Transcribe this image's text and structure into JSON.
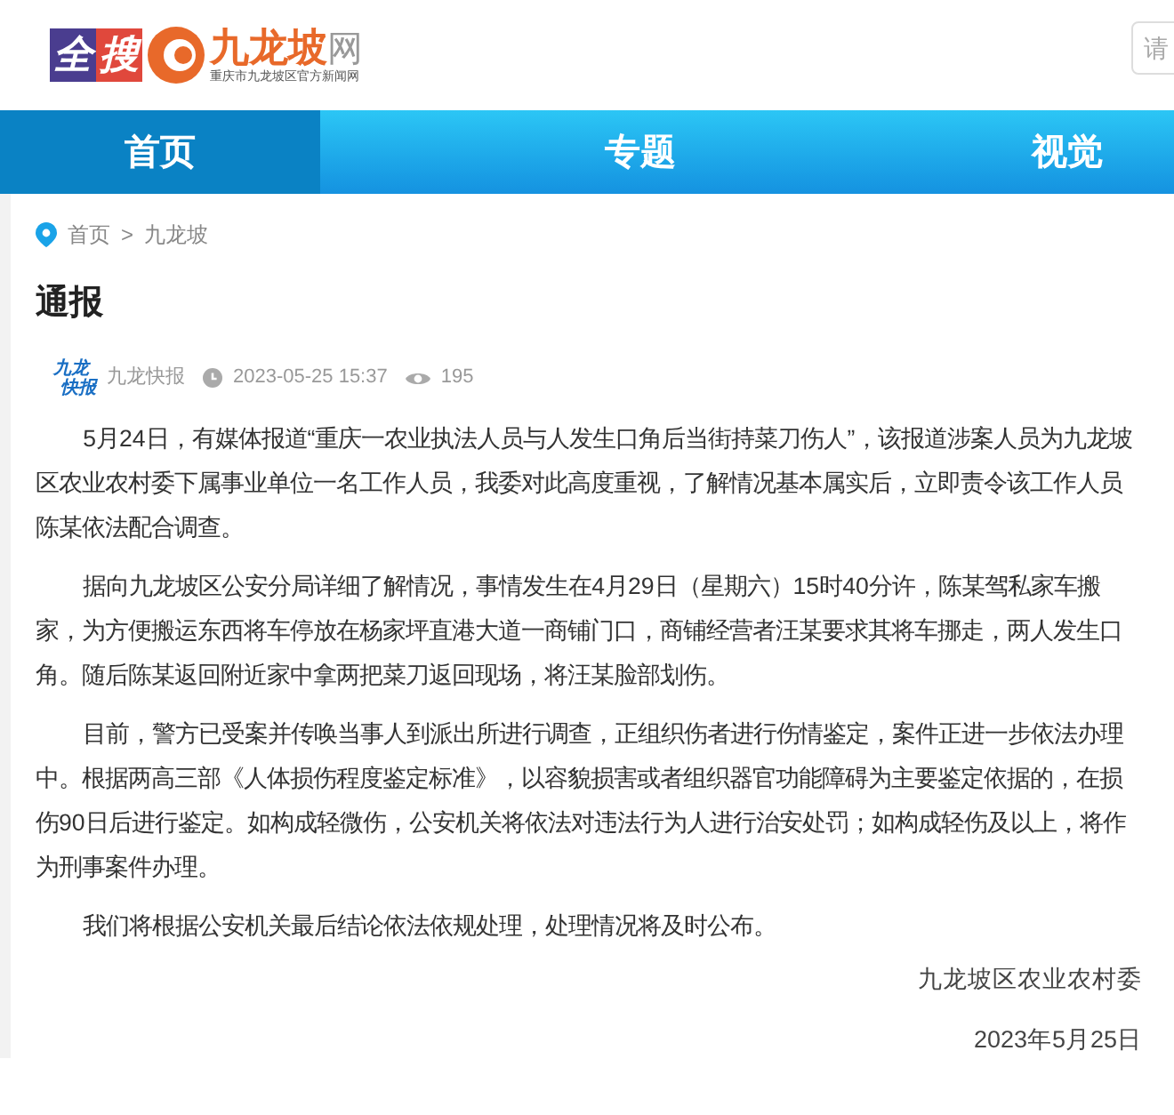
{
  "header": {
    "logo_badge": [
      "全",
      "搜"
    ],
    "logo_name": "九龙坡",
    "logo_suffix": "网",
    "logo_subtitle": "重庆市九龙坡区官方新闻网",
    "search": {
      "placeholder": "请"
    }
  },
  "nav": {
    "tabs": [
      {
        "label": "首页",
        "selected": true
      },
      {
        "label": "专题",
        "selected": false
      },
      {
        "label": "视觉",
        "selected": false
      }
    ]
  },
  "breadcrumb": {
    "items": [
      "首页",
      "九龙坡"
    ],
    "separator": ">"
  },
  "article": {
    "title": "通报",
    "avatar": [
      "九龙",
      "快报"
    ],
    "source": "九龙快报",
    "time": "2023-05-25 15:37",
    "views": "195",
    "paragraphs": [
      "5月24日，有媒体报道“重庆一农业执法人员与人发生口角后当街持菜刀伤人”，该报道涉案人员为九龙坡区农业农村委下属事业单位一名工作人员，我委对此高度重视，了解情况基本属实后，立即责令该工作人员陈某依法配合调查。",
      "据向九龙坡区公安分局详细了解情况，事情发生在4月29日（星期六）15时40分许，陈某驾私家车搬家，为方便搬运东西将车停放在杨家坪直港大道一商铺门口，商铺经营者汪某要求其将车挪走，两人发生口角。随后陈某返回附近家中拿两把菜刀返回现场，将汪某脸部划伤。",
      "目前，警方已受案并传唤当事人到派出所进行调查，正组织伤者进行伤情鉴定，案件正进一步依法办理中。根据两高三部《人体损伤程度鉴定标准》，以容貌损害或者组织器官功能障碍为主要鉴定依据的，在损伤90日后进行鉴定。如构成轻微伤，公安机关将依法对违法行为人进行治安处罚；如构成轻伤及以上，将作为刑事案件办理。",
      "我们将根据公安机关最后结论依法依规处理，处理情况将及时公布。"
    ],
    "signature": "九龙坡区农业农村委",
    "date": "2023年5月25日"
  }
}
